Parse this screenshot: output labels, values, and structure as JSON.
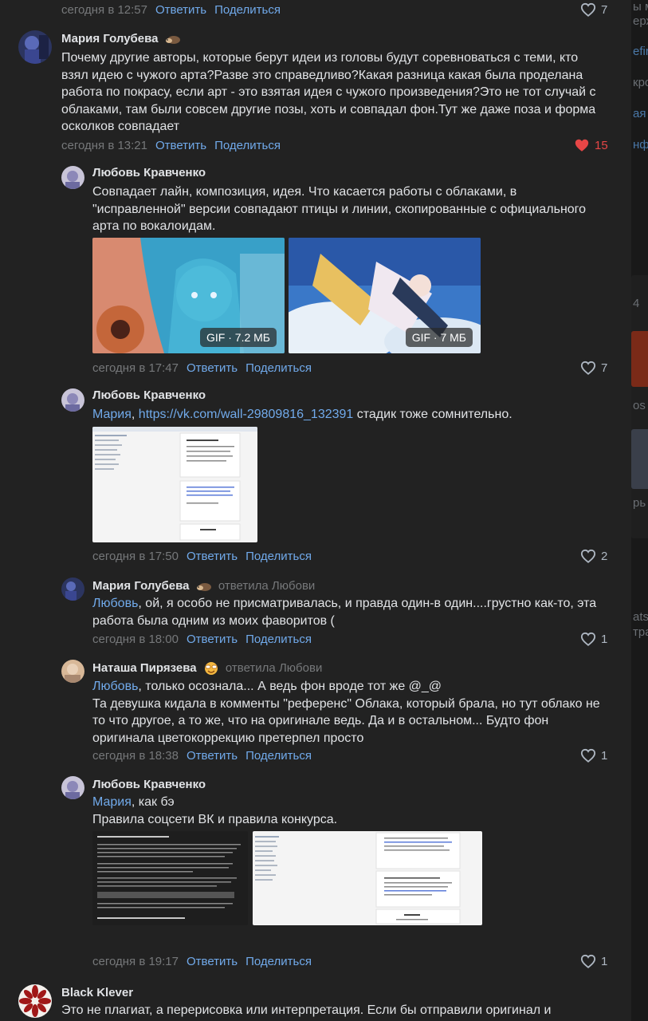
{
  "comments": [
    {
      "meta": {
        "time": "сегодня в 12:57",
        "reply": "Ответить",
        "share": "Поделиться"
      },
      "likes": "7"
    },
    {
      "author": "Мария Голубева",
      "emoji_icon": "hedgehog-emoji-icon",
      "text_lines": [
        "Почему другие авторы, которые берут идеи из головы будут соревноваться с теми, кто",
        "взял идею с чужого арта?Разве это справедливо?Какая разница какая была проделана",
        "работа по покрасу, если арт - это взятая идея с чужого произведения?Это не тот случай с",
        "облаками, там были совсем другие позы, хоть и совпадал фон.Тут же даже поза и форма",
        "осколков совпадает"
      ],
      "meta": {
        "time": "сегодня в 13:21",
        "reply": "Ответить",
        "share": "Поделиться"
      },
      "likes": "15",
      "liked": true
    },
    {
      "author": "Любовь Кравченко",
      "text_lines": [
        "Совпадает лайн, композиция, идея. Что касается работы с облаками, в",
        "\"исправленной\" версии совпадают птицы и линии, скопированные с официального",
        "арта по вокалоидам."
      ],
      "attachments": [
        {
          "badge": "GIF · 7.2 МБ"
        },
        {
          "badge": "GIF · 7 МБ"
        }
      ],
      "meta": {
        "time": "сегодня в 17:47",
        "reply": "Ответить",
        "share": "Поделиться"
      },
      "likes": "7"
    },
    {
      "author": "Любовь Кравченко",
      "mention": "Мария",
      "link": "https://vk.com/wall-29809816_132391",
      "text_rest": " стадик тоже сомнительно.",
      "meta": {
        "time": "сегодня в 17:50",
        "reply": "Ответить",
        "share": "Поделиться"
      },
      "likes": "2"
    },
    {
      "author": "Мария Голубева",
      "emoji_icon": "hedgehog-emoji-icon",
      "reply_to": "ответила Любови",
      "mention": "Любовь",
      "text_first": ", ой, я особо не присматривалась, и правда один-в один....грустно как-то, эта",
      "text_lines": [
        "работа была одним из моих фаворитов ("
      ],
      "meta": {
        "time": "сегодня в 18:00",
        "reply": "Ответить",
        "share": "Поделиться"
      },
      "likes": "1"
    },
    {
      "author": "Наташа Пирязева",
      "emoji_icon": "smiling-face-emoji-icon",
      "reply_to": "ответила Любови",
      "mention": "Любовь",
      "text_first": ", только осознала... А ведь фон вроде тот же @_@",
      "text_lines": [
        "Та девушка кидала в комменты \"референс\" Облака, который брала, но тут облако не",
        "то что другое, а то же, что на оригинале ведь. Да и в остальном... Будто фон",
        "оригинала цветокоррекцию претерпел просто"
      ],
      "meta": {
        "time": "сегодня в 18:38",
        "reply": "Ответить",
        "share": "Поделиться"
      },
      "likes": "1"
    },
    {
      "author": "Любовь Кравченко",
      "mention": "Мария",
      "text_first": ", как бэ",
      "text_lines": [
        "Правила соцсети ВК и правила конкурса."
      ],
      "meta": {
        "time": "сегодня в 19:17",
        "reply": "Ответить",
        "share": "Поделиться"
      },
      "likes": "1"
    },
    {
      "author": "Black Klever",
      "text_lines": [
        "Это не плагиат, а перерисовка или интерпретация. Если бы отправили оригинал и"
      ]
    }
  ],
  "right_panel": {
    "lines": [
      "ы ме",
      "ерж",
      "efir",
      "кро",
      "ая",
      "нфо",
      "4",
      "os",
      "рь",
      "atsu",
      "тра"
    ]
  },
  "colors": {
    "background": "#222222",
    "text": "#e1e3e6",
    "secondary": "#76787a",
    "link": "#71aaeb",
    "liked": "#e64646"
  }
}
